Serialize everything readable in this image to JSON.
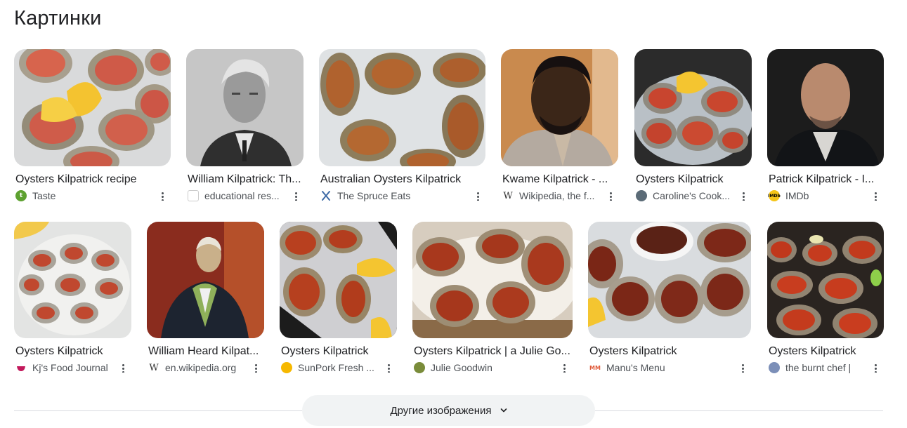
{
  "heading": "Картинки",
  "rows": [
    [
      {
        "title": "Oysters Kilpatrick recipe",
        "source": "Taste",
        "favicon": "taste-icon",
        "favicon_color": "#5da130",
        "favicon_text": "t",
        "image": "oysters-lemon-image"
      },
      {
        "title": "William Kilpatrick: Th...",
        "source": "educational res...",
        "favicon": "document-icon",
        "favicon_color": "#ffffff",
        "favicon_text": "",
        "image": "old-man-portrait-image"
      },
      {
        "title": "Australian Oysters Kilpatrick",
        "source": "The Spruce Eats",
        "favicon": "utensils-icon",
        "favicon_color": "#ffffff",
        "favicon_text": "",
        "image": "oysters-ice-image"
      },
      {
        "title": "Kwame Kilpatrick - ...",
        "source": "Wikipedia, the f...",
        "favicon": "wikipedia-icon",
        "favicon_color": "#ffffff",
        "favicon_text": "W",
        "image": "man-portrait-image"
      },
      {
        "title": "Oysters Kilpatrick",
        "source": "Caroline's Cook...",
        "favicon": "avatar-icon",
        "favicon_color": "#5b6b77",
        "favicon_text": "",
        "image": "oysters-plate-image"
      },
      {
        "title": "Patrick Kilpatrick - I...",
        "source": "IMDb",
        "favicon": "imdb-icon",
        "favicon_color": "#f5c518",
        "favicon_text": "IMDb",
        "image": "actor-portrait-image"
      }
    ],
    [
      {
        "title": "Oysters Kilpatrick",
        "source": "Kj's Food Journal",
        "favicon": "bowl-icon",
        "favicon_color": "#c2185b",
        "favicon_text": "",
        "image": "oysters-white-plate-image"
      },
      {
        "title": "William Heard Kilpat...",
        "source": "en.wikipedia.org",
        "favicon": "wikipedia-icon",
        "favicon_color": "#ffffff",
        "favicon_text": "W",
        "image": "painting-portrait-image"
      },
      {
        "title": "Oysters Kilpatrick",
        "source": "SunPork Fresh ...",
        "favicon": "sun-icon",
        "favicon_color": "#f6b800",
        "favicon_text": "",
        "image": "oysters-salt-image"
      },
      {
        "title": "Oysters Kilpatrick | a Julie Go...",
        "source": "Julie Goodwin",
        "favicon": "leaf-icon",
        "favicon_color": "#7a8c3a",
        "favicon_text": "",
        "image": "oysters-bacon-image"
      },
      {
        "title": "Oysters Kilpatrick",
        "source": "Manu's Menu",
        "favicon": "manu-icon",
        "favicon_color": "#ffffff",
        "favicon_text": "MM",
        "image": "oysters-sauce-bowl-image"
      },
      {
        "title": "Oysters Kilpatrick",
        "source": "the burnt chef |",
        "favicon": "globe-icon",
        "favicon_color": "#7c8fb8",
        "favicon_text": "",
        "image": "oysters-tray-image"
      }
    ]
  ],
  "more_button": {
    "label": "Другие изображения",
    "icon": "chevron-down-icon"
  }
}
